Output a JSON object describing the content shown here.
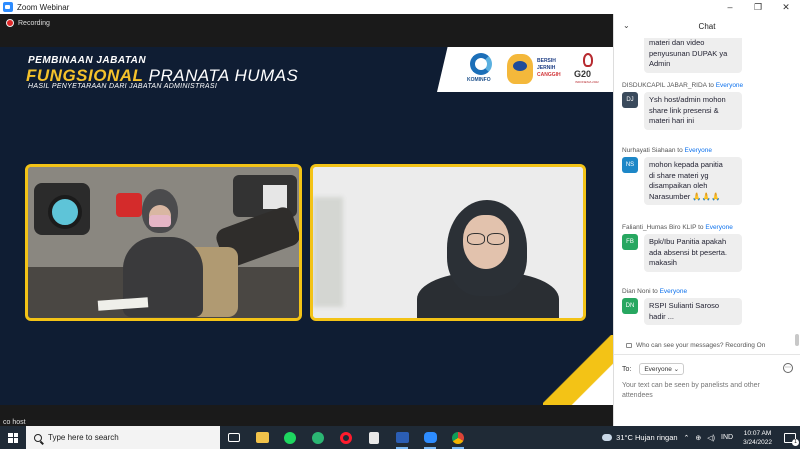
{
  "window": {
    "title": "Zoom Webinar",
    "controls": [
      "–",
      "❐",
      "✕"
    ]
  },
  "recording": {
    "label": "Recording"
  },
  "slide": {
    "line1": "PEMBINAAN JABATAN",
    "line2_bold": "FUNGSIONAL",
    "line2_rest": " PRANATA HUMAS",
    "line3": "HASIL PENYETARAAN DARI JABATAN ADMINISTRASI",
    "logos": {
      "kominfo": "KOMINFO",
      "bjc": [
        "BERSIH",
        "JERNIH",
        "CANGGIH"
      ],
      "g20": "G20",
      "g20_sub": "INDONESIA 2022"
    }
  },
  "video_tile2_label": "",
  "cohost_label": "co host",
  "chat": {
    "title": "Chat",
    "messages": [
      {
        "from": "",
        "to": "",
        "initials": "",
        "avatar_color": "#ffffff",
        "lines": [
          "materi dan video",
          "penyusunan DUPAK ya",
          "Admin"
        ]
      },
      {
        "from": "DISDUKCAPIL JABAR_RIDA",
        "to": "Everyone",
        "initials": "DJ",
        "avatar_color": "#3a4a5c",
        "lines": [
          "Ysh host/admin mohon",
          "share link presensi &",
          "materi hari ini"
        ]
      },
      {
        "from": "Nurhayati Siahaan",
        "to": "Everyone",
        "initials": "NS",
        "avatar_color": "#1d87c7",
        "lines": [
          "mohon kepada panitia",
          "di share materi yg",
          "disampaikan oleh",
          "Narasumber 🙏🙏🙏"
        ]
      },
      {
        "from": "Falianti_Humas Biro KLIP",
        "to": "Everyone",
        "initials": "FB",
        "avatar_color": "#27a760",
        "lines": [
          "Bpk/Ibu Panitia apakah",
          "ada absensi bt peserta.",
          "makasih"
        ]
      },
      {
        "from": "Dian Noni",
        "to": "Everyone",
        "initials": "DN",
        "avatar_color": "#27a760",
        "lines": [
          "RSPI Sulianti Saroso",
          "hadir ..."
        ]
      }
    ],
    "to_word": "to",
    "privacy": "Who can see your messages? Recording On",
    "to_label": "To:",
    "to_value": "Everyone",
    "input_placeholder": "Your text can be seen by panelists and other attendees"
  },
  "taskbar": {
    "search_placeholder": "Type here to search",
    "apps": [
      "task-view",
      "file-explorer",
      "spotify",
      "edge",
      "opera",
      "notepad",
      "word",
      "zoom",
      "chrome"
    ],
    "weather": "31°C  Hujan ringan",
    "lang": "IND",
    "time": "10:07 AM",
    "date": "3/24/2022",
    "notif_count": "1"
  }
}
